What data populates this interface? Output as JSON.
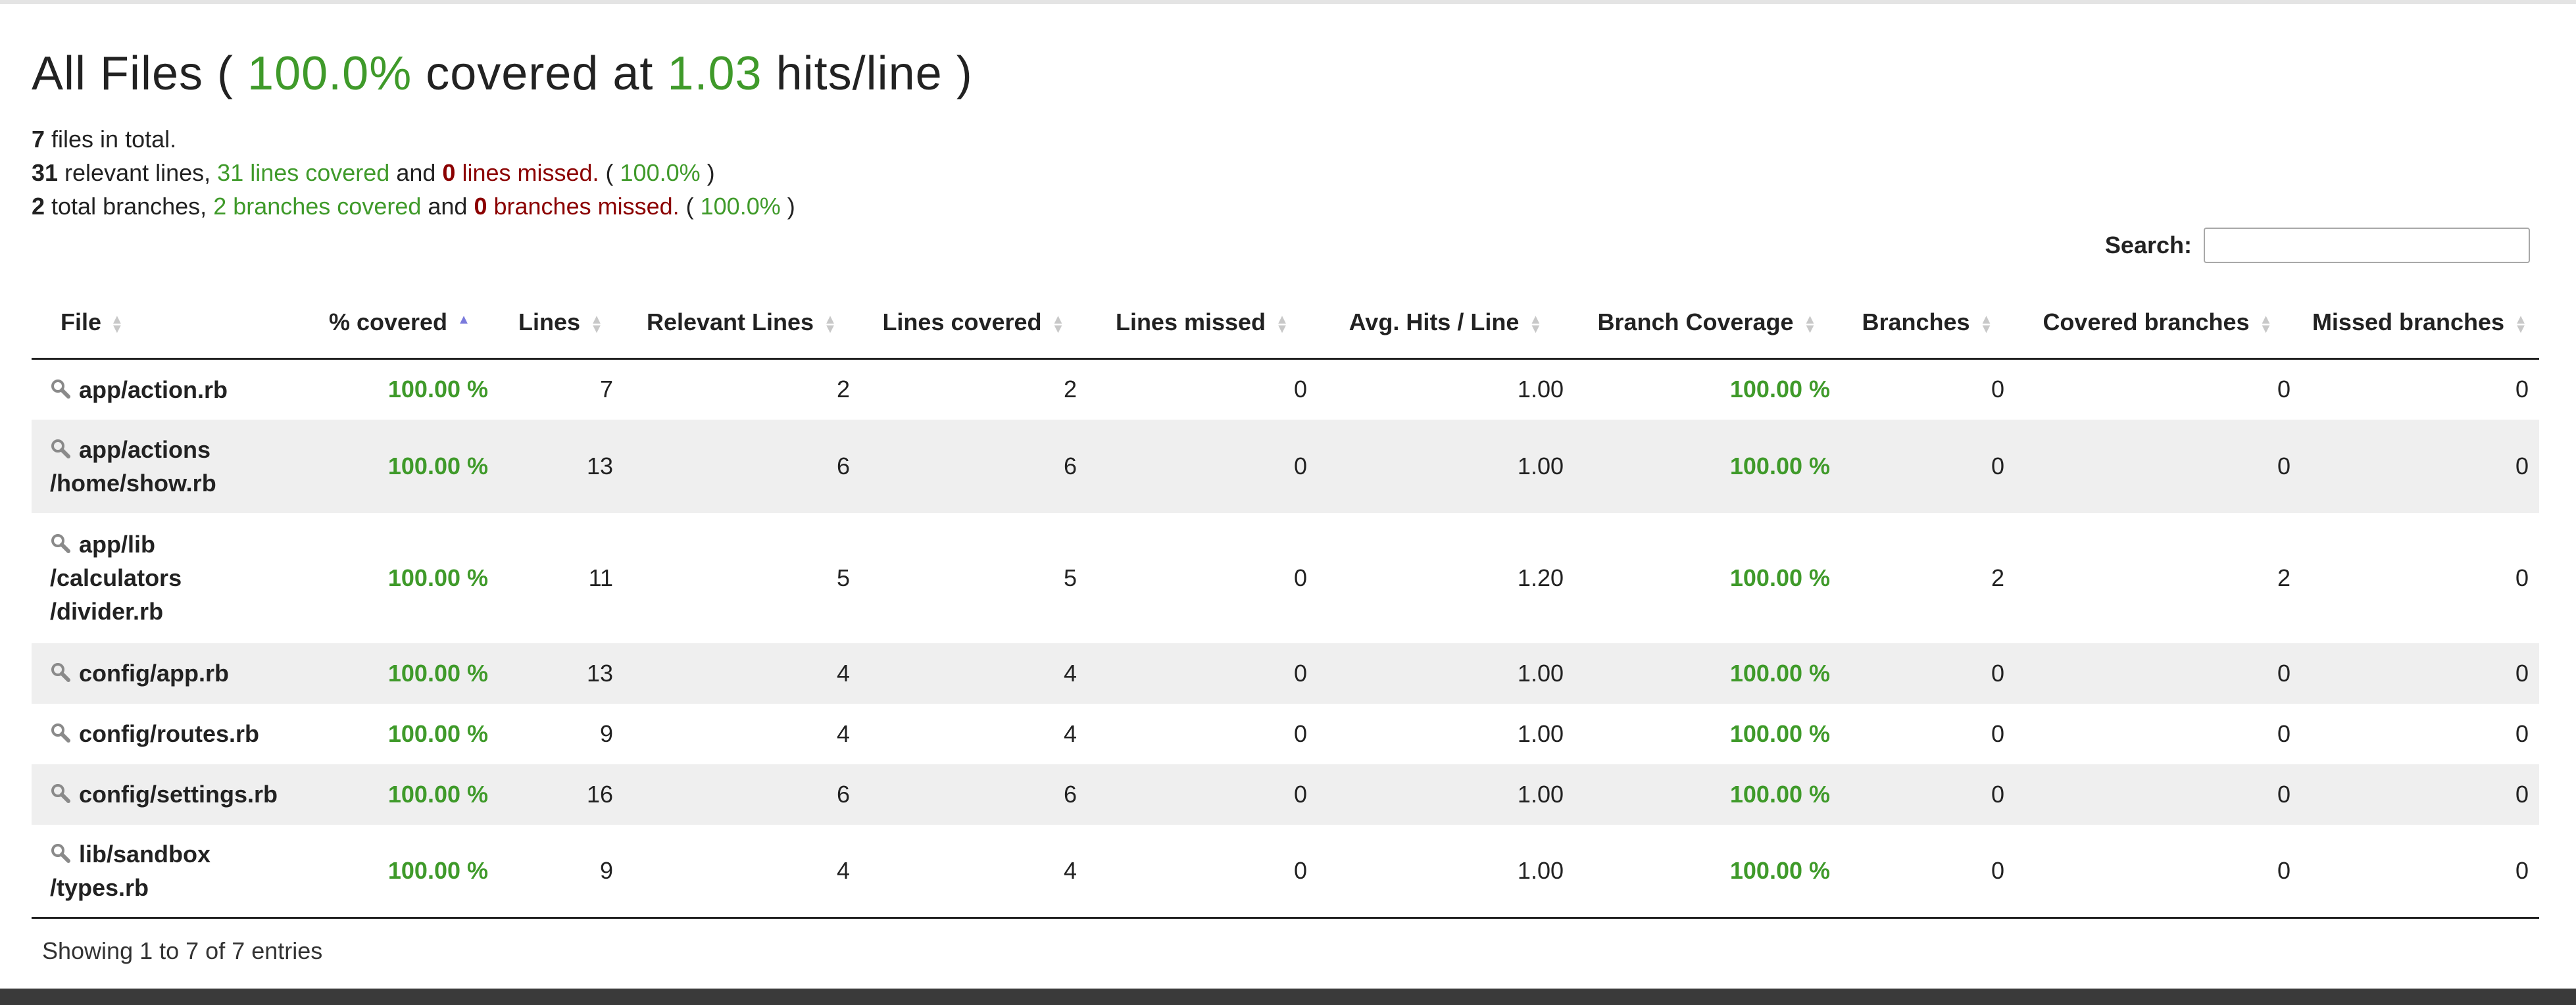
{
  "title": {
    "prefix": "All Files ( ",
    "percent": "100.0%",
    "mid": " covered at ",
    "hits": "1.03",
    "suffix": " hits/line )"
  },
  "summary": {
    "files_count": "7",
    "files_text": " files in total.",
    "relevant_count": "31",
    "relevant_text": " relevant lines, ",
    "covered_lines": "31 lines covered",
    "and1": " and ",
    "missed_count": "0",
    "missed_text": " lines missed.",
    "lines_pct_open": " ( ",
    "lines_pct": "100.0%",
    "lines_pct_close": " )",
    "branches_count": "2",
    "branches_text": " total branches, ",
    "branches_covered": "2 branches covered",
    "and2": " and ",
    "branches_missed_count": "0",
    "branches_missed_text": " branches missed.",
    "branches_pct_open": " ( ",
    "branches_pct": "100.0%",
    "branches_pct_close": " )"
  },
  "search": {
    "label": "Search:",
    "value": ""
  },
  "columns": [
    "File",
    "% covered",
    "Lines",
    "Relevant Lines",
    "Lines covered",
    "Lines missed",
    "Avg. Hits / Line",
    "Branch Coverage",
    "Branches",
    "Covered branches",
    "Missed branches"
  ],
  "rows": [
    {
      "file": [
        "app/action.rb"
      ],
      "covered": "100.00 %",
      "lines": "7",
      "relevant": "2",
      "lines_covered": "2",
      "lines_missed": "0",
      "avg_hits": "1.00",
      "branch_cov": "100.00 %",
      "branches": "0",
      "covered_branches": "0",
      "missed_branches": "0"
    },
    {
      "file": [
        "app/actions",
        "/home/show.rb"
      ],
      "covered": "100.00 %",
      "lines": "13",
      "relevant": "6",
      "lines_covered": "6",
      "lines_missed": "0",
      "avg_hits": "1.00",
      "branch_cov": "100.00 %",
      "branches": "0",
      "covered_branches": "0",
      "missed_branches": "0"
    },
    {
      "file": [
        "app/lib",
        "/calculators",
        "/divider.rb"
      ],
      "covered": "100.00 %",
      "lines": "11",
      "relevant": "5",
      "lines_covered": "5",
      "lines_missed": "0",
      "avg_hits": "1.20",
      "branch_cov": "100.00 %",
      "branches": "2",
      "covered_branches": "2",
      "missed_branches": "0"
    },
    {
      "file": [
        "config/app.rb"
      ],
      "covered": "100.00 %",
      "lines": "13",
      "relevant": "4",
      "lines_covered": "4",
      "lines_missed": "0",
      "avg_hits": "1.00",
      "branch_cov": "100.00 %",
      "branches": "0",
      "covered_branches": "0",
      "missed_branches": "0"
    },
    {
      "file": [
        "config/routes.rb"
      ],
      "covered": "100.00 %",
      "lines": "9",
      "relevant": "4",
      "lines_covered": "4",
      "lines_missed": "0",
      "avg_hits": "1.00",
      "branch_cov": "100.00 %",
      "branches": "0",
      "covered_branches": "0",
      "missed_branches": "0"
    },
    {
      "file": [
        "config/settings.rb"
      ],
      "covered": "100.00 %",
      "lines": "16",
      "relevant": "6",
      "lines_covered": "6",
      "lines_missed": "0",
      "avg_hits": "1.00",
      "branch_cov": "100.00 %",
      "branches": "0",
      "covered_branches": "0",
      "missed_branches": "0"
    },
    {
      "file": [
        "lib/sandbox",
        "/types.rb"
      ],
      "covered": "100.00 %",
      "lines": "9",
      "relevant": "4",
      "lines_covered": "4",
      "lines_missed": "0",
      "avg_hits": "1.00",
      "branch_cov": "100.00 %",
      "branches": "0",
      "covered_branches": "0",
      "missed_branches": "0"
    }
  ],
  "footer": {
    "info": "Showing 1 to 7 of 7 entries"
  },
  "colors": {
    "covered_green": "#3f9a2a",
    "missed_red": "#8b0000",
    "sort_active": "#7a7adc"
  },
  "icons": {
    "file_link": "magnifier-icon",
    "sort": "sort-arrows-icon"
  }
}
